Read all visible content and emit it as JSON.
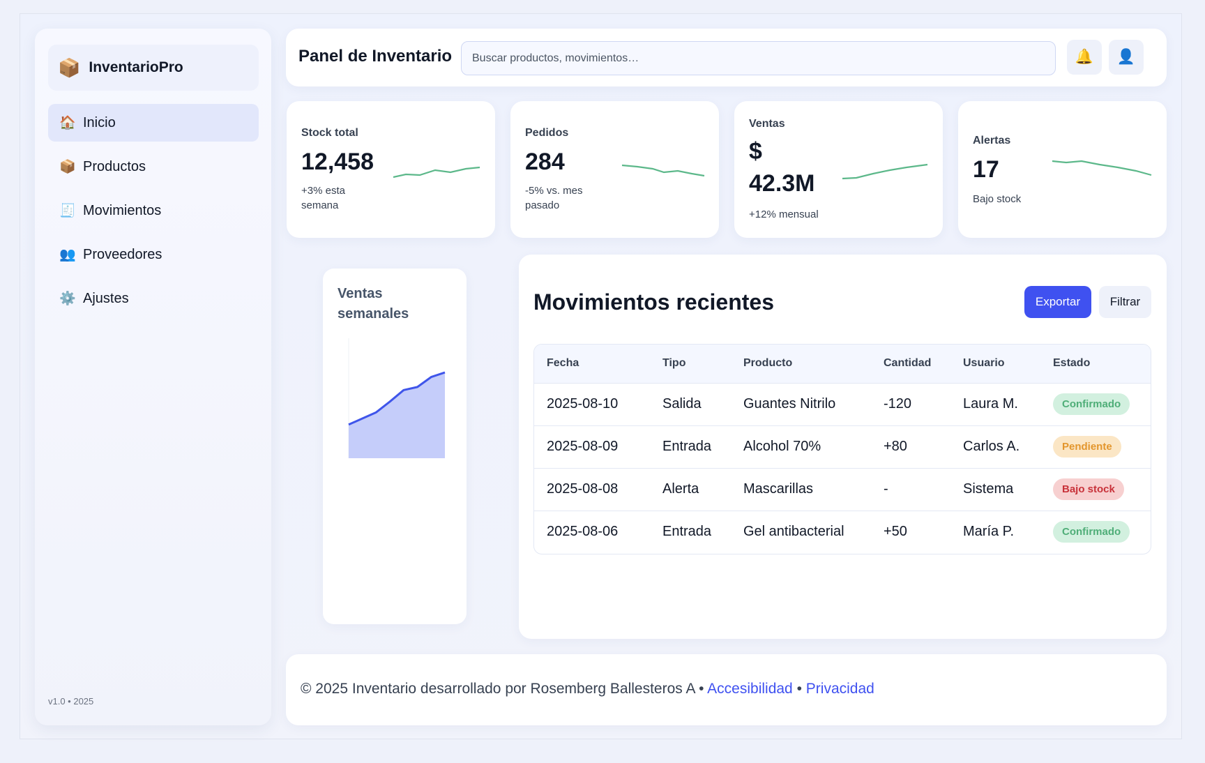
{
  "app": {
    "brand_icon": "📦",
    "brand_name": "InventarioPro",
    "version": "v1.0 • 2025"
  },
  "sidebar": {
    "items": [
      {
        "icon": "🏠",
        "icon_name": "home-icon",
        "label": "Inicio",
        "active": true
      },
      {
        "icon": "📦",
        "icon_name": "box-icon",
        "label": "Productos"
      },
      {
        "icon": "🧾",
        "icon_name": "receipt-icon",
        "label": "Movimientos"
      },
      {
        "icon": "👥",
        "icon_name": "people-icon",
        "label": "Proveedores"
      },
      {
        "icon": "⚙️",
        "icon_name": "gear-icon",
        "label": "Ajustes"
      }
    ]
  },
  "header": {
    "title": "Panel de Inventario",
    "search_placeholder": "Buscar productos, movimientos…",
    "bell_icon": "🔔",
    "user_icon": "👤"
  },
  "stats": [
    {
      "label": "Stock total",
      "value": "12,458",
      "sub": "+3% esta semana"
    },
    {
      "label": "Pedidos",
      "value": "284",
      "sub": "-5% vs. mes pasado"
    },
    {
      "label": "Ventas",
      "value": "$ 42.3M",
      "sub": "+12% mensual"
    },
    {
      "label": "Alertas",
      "value": "17",
      "sub": "Bajo stock"
    }
  ],
  "colors": {
    "accent": "#3f51f0",
    "sparkline": "#5cb88a",
    "area_fill": "#c5cdfa",
    "area_line": "#3f55ea"
  },
  "weekly": {
    "title": "Ventas semanales",
    "chart_data": {
      "type": "area",
      "values": [
        22,
        30,
        38,
        52,
        67,
        71,
        84,
        90
      ]
    }
  },
  "moves": {
    "title": "Movimientos recientes",
    "export_label": "Exportar",
    "filter_label": "Filtrar",
    "columns": [
      "Fecha",
      "Tipo",
      "Producto",
      "Cantidad",
      "Usuario",
      "Estado"
    ],
    "rows": [
      {
        "fecha": "2025-08-10",
        "tipo": "Salida",
        "producto": "Guantes Nitrilo",
        "cantidad": "-120",
        "usuario": "Laura M.",
        "estado": "Confirmado"
      },
      {
        "fecha": "2025-08-09",
        "tipo": "Entrada",
        "producto": "Alcohol 70%",
        "cantidad": "+80",
        "usuario": "Carlos A.",
        "estado": "Pendiente"
      },
      {
        "fecha": "2025-08-08",
        "tipo": "Alerta",
        "producto": "Mascarillas",
        "cantidad": "-",
        "usuario": "Sistema",
        "estado": "Bajo stock"
      },
      {
        "fecha": "2025-08-06",
        "tipo": "Entrada",
        "producto": "Gel antibacterial",
        "cantidad": "+50",
        "usuario": "María P.",
        "estado": "Confirmado"
      }
    ]
  },
  "footer": {
    "text": "© 2025 Inventario desarrollado por Rosemberg Ballesteros A •",
    "link1": "Accesibilidad",
    "sep": "•",
    "link2": "Privacidad"
  }
}
